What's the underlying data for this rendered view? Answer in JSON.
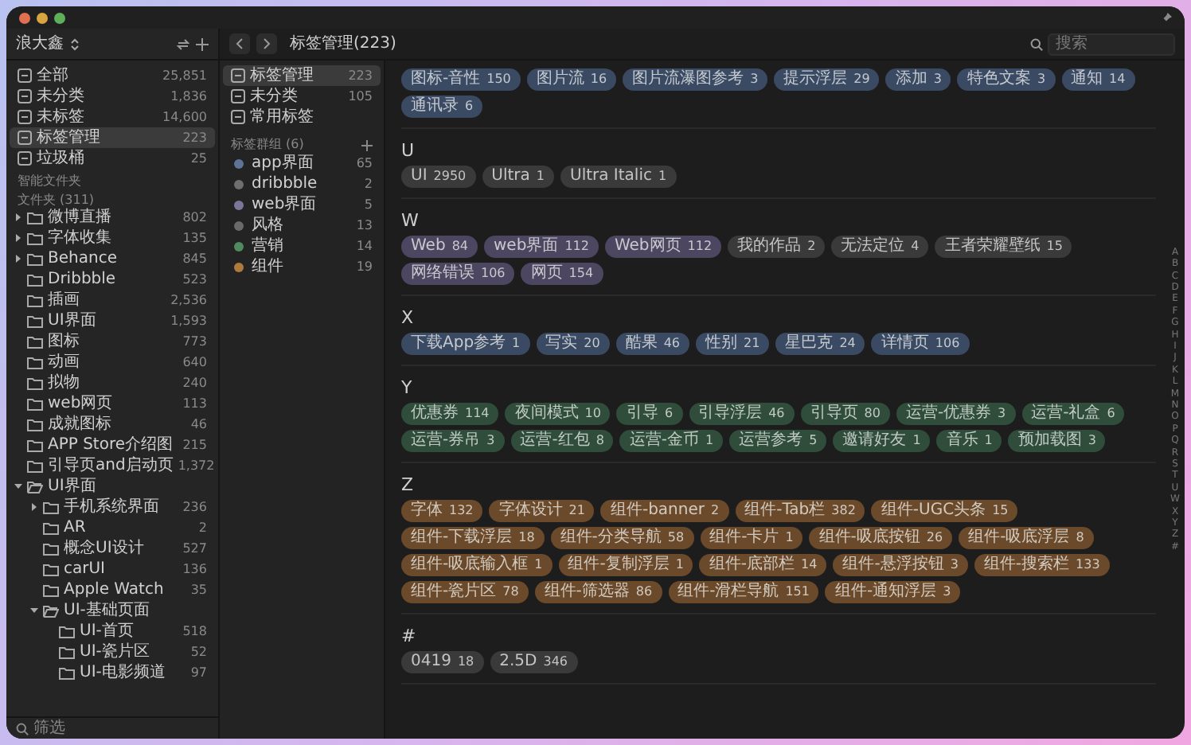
{
  "sidebar": {
    "account": "浪大鑫",
    "library": [
      {
        "label": "全部",
        "count": "25,851",
        "selected": false
      },
      {
        "label": "未分类",
        "count": "1,836",
        "selected": false
      },
      {
        "label": "未标签",
        "count": "14,600",
        "selected": false
      },
      {
        "label": "标签管理",
        "count": "223",
        "selected": true
      },
      {
        "label": "垃圾桶",
        "count": "25",
        "selected": false
      }
    ],
    "smart_folders_label": "智能文件夹",
    "folders_label": "文件夹 (311)",
    "folders": [
      {
        "label": "微博直播",
        "count": "802",
        "expanded": false
      },
      {
        "label": "字体收集",
        "count": "135",
        "expanded": false
      },
      {
        "label": "Behance",
        "count": "845",
        "expanded": false
      },
      {
        "label": "Dribbble",
        "count": "523"
      },
      {
        "label": "插画",
        "count": "2,536"
      },
      {
        "label": "UI界面",
        "count": "1,593"
      },
      {
        "label": "图标",
        "count": "773"
      },
      {
        "label": "动画",
        "count": "640"
      },
      {
        "label": "拟物",
        "count": "240"
      },
      {
        "label": "web网页",
        "count": "113"
      },
      {
        "label": "成就图标",
        "count": "46"
      },
      {
        "label": "APP Store介绍图",
        "count": "215"
      },
      {
        "label": "引导页and启动页",
        "count": "1,372"
      },
      {
        "label": "UI界面",
        "expanded": true,
        "children": [
          {
            "label": "手机系统界面",
            "count": "236",
            "expanded": false
          },
          {
            "label": "AR",
            "count": "2"
          },
          {
            "label": "概念UI设计",
            "count": "527"
          },
          {
            "label": "carUI",
            "count": "136"
          },
          {
            "label": "Apple Watch",
            "count": "35"
          },
          {
            "label": "UI-基础页面",
            "expanded": true,
            "children": [
              {
                "label": "UI-首页",
                "count": "518"
              },
              {
                "label": "UI-瓷片区",
                "count": "52"
              },
              {
                "label": "UI-电影频道",
                "count": "97"
              }
            ]
          }
        ]
      }
    ],
    "filter_label": "筛选"
  },
  "toolbar": {
    "title": "标签管理(223)",
    "search": {
      "placeholder": "搜索"
    }
  },
  "tag_panel": {
    "items": [
      {
        "label": "标签管理",
        "count": "223",
        "selected": true
      },
      {
        "label": "未分类",
        "count": "105",
        "selected": false
      },
      {
        "label": "常用标签",
        "selected": false
      }
    ],
    "groups_label": "标签群组 (6)",
    "groups": [
      {
        "label": "app界面",
        "count": "65",
        "color": "#5f7396"
      },
      {
        "label": "dribbble",
        "count": "2",
        "color": "#6e6e6e"
      },
      {
        "label": "web界面",
        "count": "5",
        "color": "#7d7598"
      },
      {
        "label": "风格",
        "count": "13",
        "color": "#6a6a6a"
      },
      {
        "label": "营销",
        "count": "14",
        "color": "#4f8a60"
      },
      {
        "label": "组件",
        "count": "19",
        "color": "#b07a3c"
      }
    ]
  },
  "tag_index": {
    "sections": [
      {
        "tags": [
          {
            "label": "图标-音性",
            "count": "150",
            "color": "#3b4a63"
          },
          {
            "label": "图片流",
            "count": "16",
            "color": "#3b4a63"
          },
          {
            "label": "图片流瀑图参考",
            "count": "3",
            "color": "#3b4a63"
          },
          {
            "label": "提示浮层",
            "count": "29",
            "color": "#3b4a63"
          },
          {
            "label": "添加",
            "count": "3",
            "color": "#3b4a63"
          },
          {
            "label": "特色文案",
            "count": "3",
            "color": "#3b4a63"
          },
          {
            "label": "通知",
            "count": "14",
            "color": "#3b4a63"
          },
          {
            "label": "通讯录",
            "count": "6",
            "color": "#3b4a63"
          }
        ]
      },
      {
        "letter": "U",
        "tags": [
          {
            "label": "UI",
            "count": "2950",
            "color": "#3a3a3a"
          },
          {
            "label": "Ultra",
            "count": "1",
            "color": "#3a3a3a"
          },
          {
            "label": "Ultra Italic",
            "count": "1",
            "color": "#3a3a3a"
          }
        ]
      },
      {
        "letter": "W",
        "tags": [
          {
            "label": "Web",
            "count": "84",
            "color": "#4c4660"
          },
          {
            "label": "web界面",
            "count": "112",
            "color": "#4c4660"
          },
          {
            "label": "Web网页",
            "count": "112",
            "color": "#4c4660"
          },
          {
            "label": "我的作品",
            "count": "2",
            "color": "#3a3a3a"
          },
          {
            "label": "无法定位",
            "count": "4",
            "color": "#3a3a3a"
          },
          {
            "label": "王者荣耀壁纸",
            "count": "15",
            "color": "#3a3a3a"
          },
          {
            "label": "网络错误",
            "count": "106",
            "color": "#4c4660"
          },
          {
            "label": "网页",
            "count": "154",
            "color": "#4c4660"
          }
        ]
      },
      {
        "letter": "X",
        "tags": [
          {
            "label": "下载App参考",
            "count": "1",
            "color": "#3b4a63"
          },
          {
            "label": "写实",
            "count": "20",
            "color": "#3b4a63"
          },
          {
            "label": "酷果",
            "count": "46",
            "color": "#3b4a63"
          },
          {
            "label": "性别",
            "count": "21",
            "color": "#3b4a63"
          },
          {
            "label": "星巴克",
            "count": "24",
            "color": "#3b4a63"
          },
          {
            "label": "详情页",
            "count": "106",
            "color": "#3b4a63"
          }
        ]
      },
      {
        "letter": "Y",
        "tags": [
          {
            "label": "优惠券",
            "count": "114",
            "color": "#2f4d3a"
          },
          {
            "label": "夜间模式",
            "count": "10",
            "color": "#2f4d3a"
          },
          {
            "label": "引导",
            "count": "6",
            "color": "#2f4d3a"
          },
          {
            "label": "引导浮层",
            "count": "46",
            "color": "#2f4d3a"
          },
          {
            "label": "引导页",
            "count": "80",
            "color": "#2f4d3a"
          },
          {
            "label": "运营-优惠券",
            "count": "3",
            "color": "#2f4d3a"
          },
          {
            "label": "运营-礼盒",
            "count": "6",
            "color": "#2f4d3a"
          },
          {
            "label": "运营-券吊",
            "count": "3",
            "color": "#2f4d3a"
          },
          {
            "label": "运营-红包",
            "count": "8",
            "color": "#2f4d3a"
          },
          {
            "label": "运营-金币",
            "count": "1",
            "color": "#2f4d3a"
          },
          {
            "label": "运营参考",
            "count": "5",
            "color": "#2f4d3a"
          },
          {
            "label": "邀请好友",
            "count": "1",
            "color": "#2f4d3a"
          },
          {
            "label": "音乐",
            "count": "1",
            "color": "#2f4d3a"
          },
          {
            "label": "预加载图",
            "count": "3",
            "color": "#2f4d3a"
          }
        ]
      },
      {
        "letter": "Z",
        "tags": [
          {
            "label": "字体",
            "count": "132",
            "color": "#6a4a2b"
          },
          {
            "label": "字体设计",
            "count": "21",
            "color": "#6a4a2b"
          },
          {
            "label": "组件-banner",
            "count": "2",
            "color": "#6a4a2b"
          },
          {
            "label": "组件-Tab栏",
            "count": "382",
            "color": "#6a4a2b"
          },
          {
            "label": "组件-UGC头条",
            "count": "15",
            "color": "#6a4a2b"
          },
          {
            "label": "组件-下载浮层",
            "count": "18",
            "color": "#6a4a2b"
          },
          {
            "label": "组件-分类导航",
            "count": "58",
            "color": "#6a4a2b"
          },
          {
            "label": "组件-卡片",
            "count": "1",
            "color": "#6a4a2b"
          },
          {
            "label": "组件-吸底按钮",
            "count": "26",
            "color": "#6a4a2b"
          },
          {
            "label": "组件-吸底浮层",
            "count": "8",
            "color": "#6a4a2b"
          },
          {
            "label": "组件-吸底输入框",
            "count": "1",
            "color": "#6a4a2b"
          },
          {
            "label": "组件-复制浮层",
            "count": "1",
            "color": "#6a4a2b"
          },
          {
            "label": "组件-底部栏",
            "count": "14",
            "color": "#6a4a2b"
          },
          {
            "label": "组件-悬浮按钮",
            "count": "3",
            "color": "#6a4a2b"
          },
          {
            "label": "组件-搜索栏",
            "count": "133",
            "color": "#6a4a2b"
          },
          {
            "label": "组件-瓷片区",
            "count": "78",
            "color": "#6a4a2b"
          },
          {
            "label": "组件-筛选器",
            "count": "86",
            "color": "#6a4a2b"
          },
          {
            "label": "组件-滑栏导航",
            "count": "151",
            "color": "#6a4a2b"
          },
          {
            "label": "组件-通知浮层",
            "count": "3",
            "color": "#6a4a2b"
          }
        ]
      },
      {
        "letter": "#",
        "tags": [
          {
            "label": "0419",
            "count": "18",
            "color": "#3a3a3a"
          },
          {
            "label": "2.5D",
            "count": "346",
            "color": "#3a3a3a"
          }
        ]
      }
    ]
  },
  "letter_index": [
    "A",
    "B",
    "C",
    "D",
    "E",
    "F",
    "G",
    "H",
    "I",
    "J",
    "K",
    "L",
    "M",
    "N",
    "O",
    "P",
    "Q",
    "R",
    "S",
    "T",
    "U",
    "W",
    "X",
    "Y",
    "Z",
    "#"
  ]
}
